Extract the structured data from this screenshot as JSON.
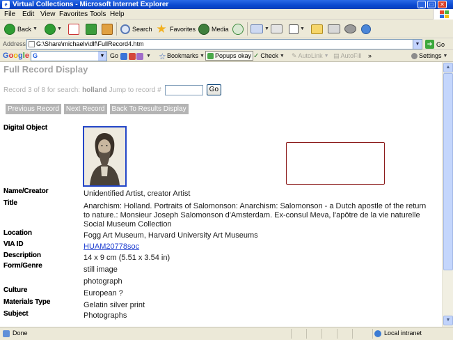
{
  "window": {
    "title": "Virtual Collections - Microsoft Internet Explorer"
  },
  "menu": [
    "File",
    "Edit",
    "View",
    "Favorites",
    "Tools",
    "Help"
  ],
  "toolbar": {
    "back": "Back",
    "search": "Search",
    "favorites": "Favorites",
    "media": "Media"
  },
  "address": {
    "label": "Address",
    "url": "G:\\Share\\michaelv\\dlf\\FullRecord4.htm",
    "go": "Go"
  },
  "googlebar": {
    "logo": "Google",
    "search_placeholder": "G",
    "go_label": "Go",
    "bookmarks": "Bookmarks",
    "popups": "Popups okay",
    "check": "Check",
    "autolink": "AutoLink",
    "autofill": "AutoFill",
    "more": "»",
    "settings": "Settings"
  },
  "page": {
    "title": "Full Record Display",
    "record_prefix": "Record 3 of 8  for search:",
    "search_term": "holland",
    "jump_label": "Jump to record #",
    "jump_go": "Go",
    "nav": {
      "previous": "Previous Record",
      "next": "Next Record",
      "back": "Back To Results Display"
    },
    "fields": {
      "digital_object": "Digital Object",
      "name_creator": "Name/Creator",
      "name_creator_value": "Unidentified Artist,  creator Artist",
      "title": "Title",
      "title_value_1": "Anarchism: Holland. Portraits of Salomonson: Anarchism: Salomonson - a Dutch apostle of the return",
      "title_value_2": "to nature.: Monsieur Joseph Salomonson d'Amsterdam. Ex-consul Meva, l'apôtre de la vie naturelle",
      "title_value_3": "Social Museum Collection",
      "location": "Location",
      "location_value": "Fogg Art Museum, Harvard University Art Museums",
      "via_id": "VIA ID",
      "via_id_value": "HUAM20778soc",
      "description": "Description",
      "description_value": "14 x 9 cm (5.51 x 3.54 in)",
      "form_genre": "Form/Genre",
      "form_genre_value_1": "still image",
      "form_genre_value_2": "photograph",
      "culture": "Culture",
      "culture_value": "European ?",
      "materials_type": "Materials Type",
      "materials_type_value": "Gelatin silver print",
      "subject": "Subject",
      "subject_value": "Photographs"
    }
  },
  "status": {
    "done": "Done",
    "zone": "Local intranet"
  }
}
